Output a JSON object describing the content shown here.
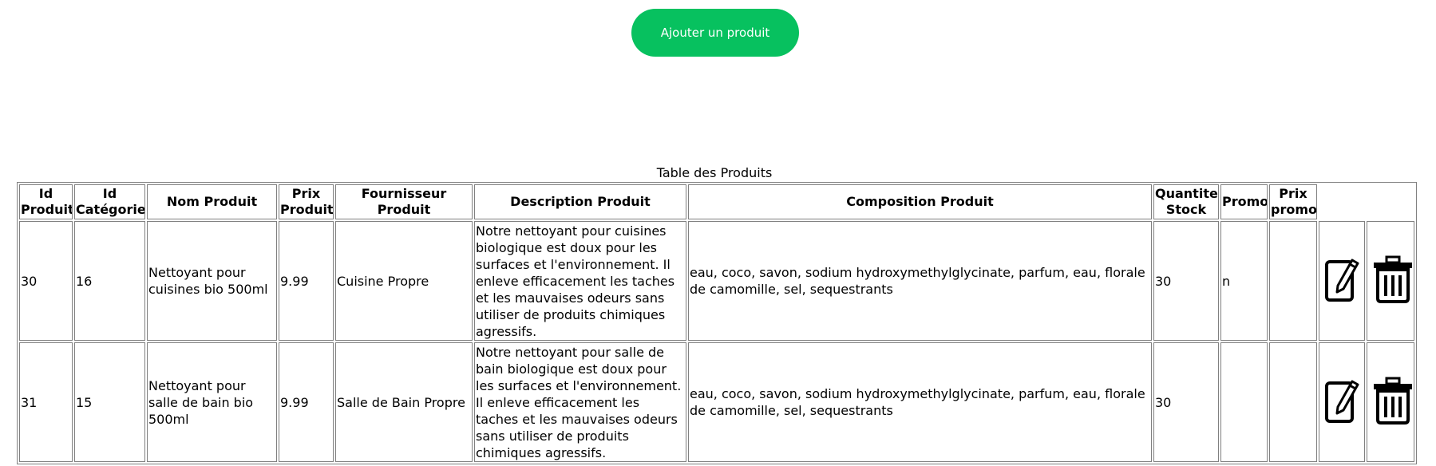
{
  "toolbar": {
    "add_product_label": "Ajouter un produit"
  },
  "table": {
    "caption": "Table des Produits",
    "headers": {
      "id_produit": [
        "Id",
        "Produit"
      ],
      "id_categorie": [
        "Id",
        "Catégorie"
      ],
      "nom_produit": "Nom Produit",
      "prix_produit": [
        "Prix",
        "Produit"
      ],
      "fournisseur_produit": [
        "Fournisseur",
        "Produit"
      ],
      "description_produit": "Description Produit",
      "composition_produit": "Composition Produit",
      "quantite_stock": [
        "Quantite",
        "Stock"
      ],
      "promo": "Promo",
      "prix_promo": [
        "Prix",
        "promo"
      ]
    },
    "rows": [
      {
        "id_produit": "30",
        "id_categorie": "16",
        "nom_produit": "Nettoyant pour cuisines bio 500ml",
        "prix_produit": "9.99",
        "fournisseur_produit": "Cuisine Propre",
        "description_produit": "Notre nettoyant pour cuisines biologique est doux pour les surfaces et l'environnement. Il enleve efficacement les taches et les mauvaises odeurs sans utiliser de produits chimiques agressifs.",
        "composition_produit": "eau, coco, savon, sodium hydroxymethylglycinate, parfum, eau, florale de camomille, sel, sequestrants",
        "quantite_stock": "30",
        "promo": "n",
        "prix_promo": ""
      },
      {
        "id_produit": "31",
        "id_categorie": "15",
        "nom_produit": "Nettoyant pour salle de bain bio 500ml",
        "prix_produit": "9.99",
        "fournisseur_produit": "Salle de Bain Propre",
        "description_produit": "Notre nettoyant pour salle de bain biologique est doux pour les surfaces et l'environnement. Il enleve efficacement les taches et les mauvaises odeurs sans utiliser de produits chimiques agressifs.",
        "composition_produit": "eau, coco, savon, sodium hydroxymethylglycinate, parfum, eau, florale de camomille, sel, sequestrants",
        "quantite_stock": "30",
        "promo": "",
        "prix_promo": ""
      }
    ]
  },
  "icons": {
    "edit": "edit-icon",
    "delete": "trash-icon"
  }
}
